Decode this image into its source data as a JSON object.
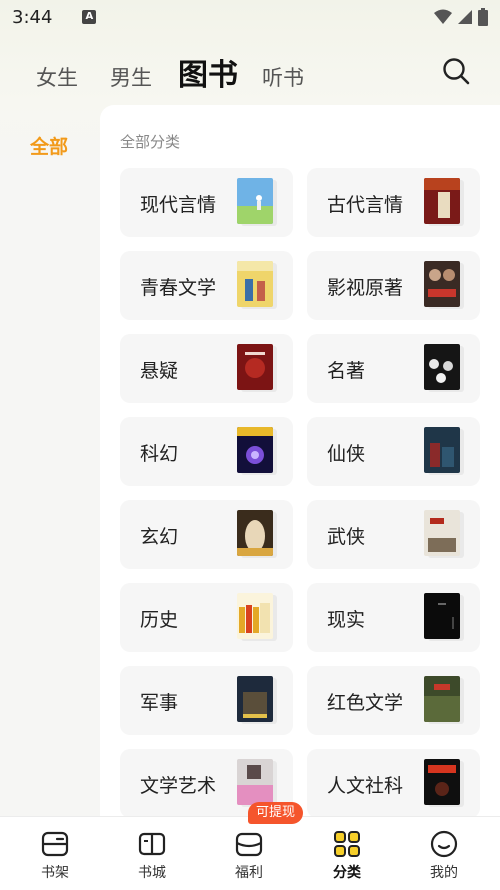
{
  "status_bar": {
    "time": "3:44",
    "app_icon_letter": "A"
  },
  "header": {
    "tabs": [
      {
        "label": "女生",
        "active": false
      },
      {
        "label": "男生",
        "active": false
      },
      {
        "label": "图书",
        "active": true
      },
      {
        "label": "听书",
        "active": false
      }
    ],
    "accent": "#f6cf2a"
  },
  "sidebar": {
    "items": [
      {
        "label": "全部",
        "active": true,
        "color": "#f29a1a"
      }
    ]
  },
  "main": {
    "section_title": "全部分类",
    "categories": [
      {
        "label": "现代言情",
        "cover": "sky"
      },
      {
        "label": "古代言情",
        "cover": "palace"
      },
      {
        "label": "青春文学",
        "cover": "youth"
      },
      {
        "label": "影视原著",
        "cover": "film"
      },
      {
        "label": "悬疑",
        "cover": "mystery"
      },
      {
        "label": "名著",
        "cover": "classic"
      },
      {
        "label": "科幻",
        "cover": "scifi"
      },
      {
        "label": "仙侠",
        "cover": "xianxia"
      },
      {
        "label": "玄幻",
        "cover": "fantasy"
      },
      {
        "label": "武侠",
        "cover": "wuxia"
      },
      {
        "label": "历史",
        "cover": "history"
      },
      {
        "label": "现实",
        "cover": "reality"
      },
      {
        "label": "军事",
        "cover": "military"
      },
      {
        "label": "红色文学",
        "cover": "red"
      },
      {
        "label": "文学艺术",
        "cover": "art"
      },
      {
        "label": "人文社科",
        "cover": "humanities"
      }
    ]
  },
  "bottom_nav": {
    "items": [
      {
        "label": "书架",
        "icon": "bookshelf-icon",
        "active": false
      },
      {
        "label": "书城",
        "icon": "book-open-icon",
        "active": false
      },
      {
        "label": "福利",
        "icon": "gift-box-icon",
        "active": false
      },
      {
        "label": "分类",
        "icon": "category-grid-icon",
        "active": true
      },
      {
        "label": "我的",
        "icon": "profile-smile-icon",
        "active": false
      }
    ],
    "badge": "可提现"
  }
}
